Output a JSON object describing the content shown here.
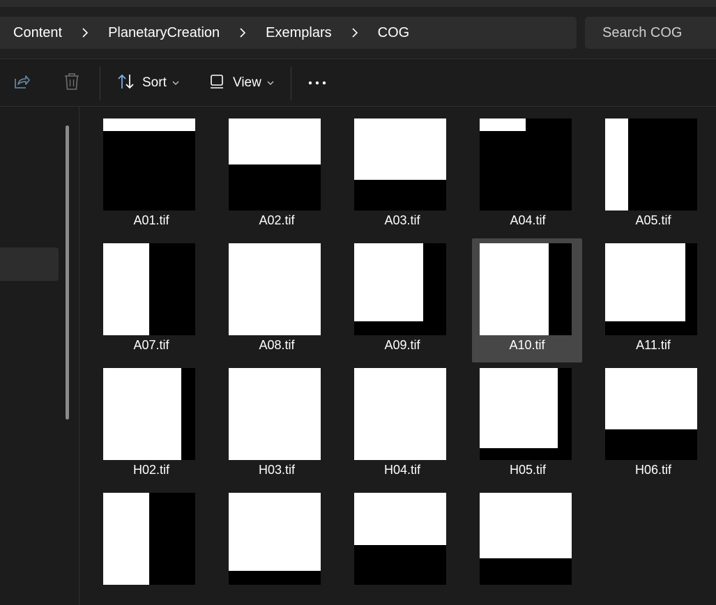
{
  "breadcrumb": {
    "items": [
      "Content",
      "PlanetaryCreation",
      "Exemplars",
      "COG"
    ]
  },
  "search": {
    "placeholder": "Search COG"
  },
  "toolbar": {
    "sort_label": "Sort",
    "view_label": "View"
  },
  "files": [
    {
      "name": "A01.tif"
    },
    {
      "name": "A02.tif"
    },
    {
      "name": "A03.tif"
    },
    {
      "name": "A04.tif"
    },
    {
      "name": "A05.tif"
    },
    {
      "name": "A07.tif"
    },
    {
      "name": "A08.tif"
    },
    {
      "name": "A09.tif"
    },
    {
      "name": "A10.tif"
    },
    {
      "name": "A11.tif"
    },
    {
      "name": "H02.tif"
    },
    {
      "name": "H03.tif"
    },
    {
      "name": "H04.tif"
    },
    {
      "name": "H05.tif"
    },
    {
      "name": "H06.tif"
    },
    {
      "name": ""
    },
    {
      "name": ""
    },
    {
      "name": ""
    },
    {
      "name": ""
    }
  ],
  "selected_file": "A10.tif",
  "colors": {
    "background": "#1c1c1c",
    "panel": "#2d2d2d",
    "selection": "#474747"
  }
}
